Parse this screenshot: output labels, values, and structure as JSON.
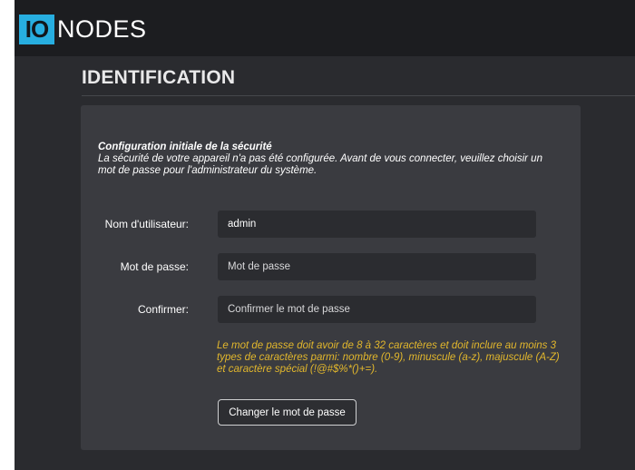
{
  "header": {
    "logo_mark": "IO",
    "logo_text": "NODES"
  },
  "page": {
    "title": "IDENTIFICATION"
  },
  "security_setup": {
    "heading": "Configuration initiale de la sécurité",
    "description": "La sécurité de votre appareil n'a pas été configurée. Avant de vous connecter, veuillez choisir un mot de passe pour l'administrateur du système."
  },
  "form": {
    "username_label": "Nom d'utilisateur:",
    "username_value": "admin",
    "password_label": "Mot de passe:",
    "password_placeholder": "Mot de passe",
    "confirm_label": "Confirmer:",
    "confirm_placeholder": "Confirmer le mot de passe",
    "password_rules": "Le mot de passe doit avoir de 8 à 32 caractères et doit inclure au moins 3 types de caractères parmi: nombre (0-9), minuscule (a-z), majuscule (A-Z) et caractère spécial (!@#$%*()+=).",
    "submit_label": "Changer le mot de passe"
  },
  "colors": {
    "brand": "#27aee0",
    "warning_text": "#e2b72c"
  }
}
